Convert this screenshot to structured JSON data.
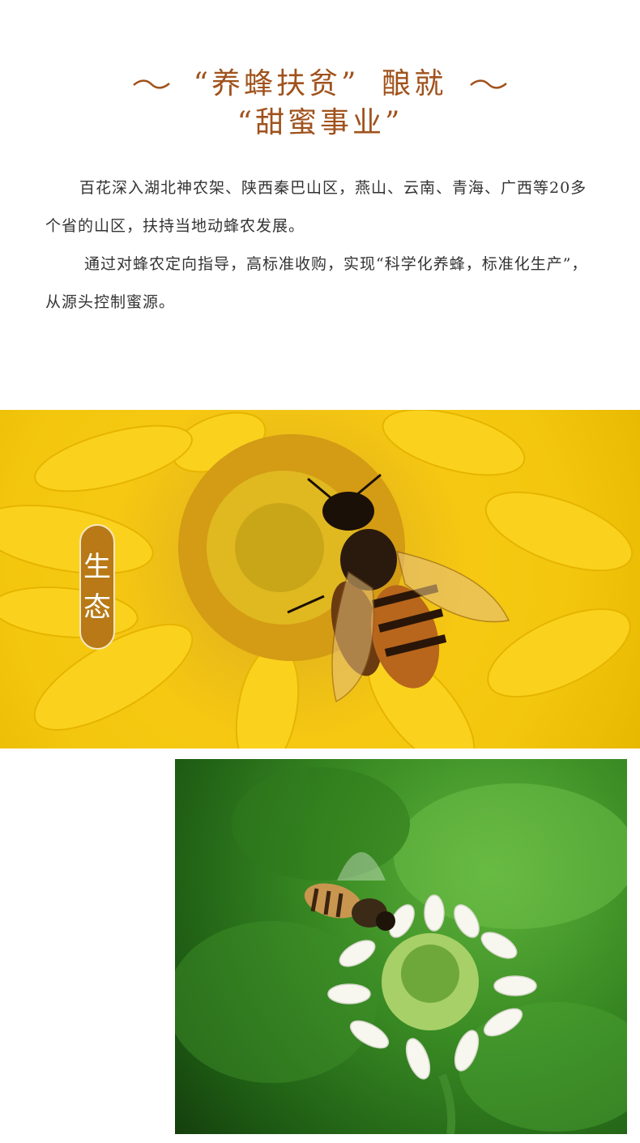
{
  "title": {
    "line1_part1": "“养蜂扶贫”",
    "line1_part2": "酿就",
    "line2": "“甜蜜事业”"
  },
  "paragraphs": [
    "百花深入湖北神农架、陕西秦巴山区，燕山、云南、青海、广西等20多个省的山区，扶持当地动蜂农发展。",
    "通过对蜂农定向指导，高标准收购，实现“科学化养蜂，标准化生产”，从源头控制蜜源。"
  ],
  "badge": {
    "char1": "生",
    "char2": "态"
  },
  "colors": {
    "title": "#a0521c",
    "badge_bg": "#b87916",
    "body_text": "#333333"
  }
}
